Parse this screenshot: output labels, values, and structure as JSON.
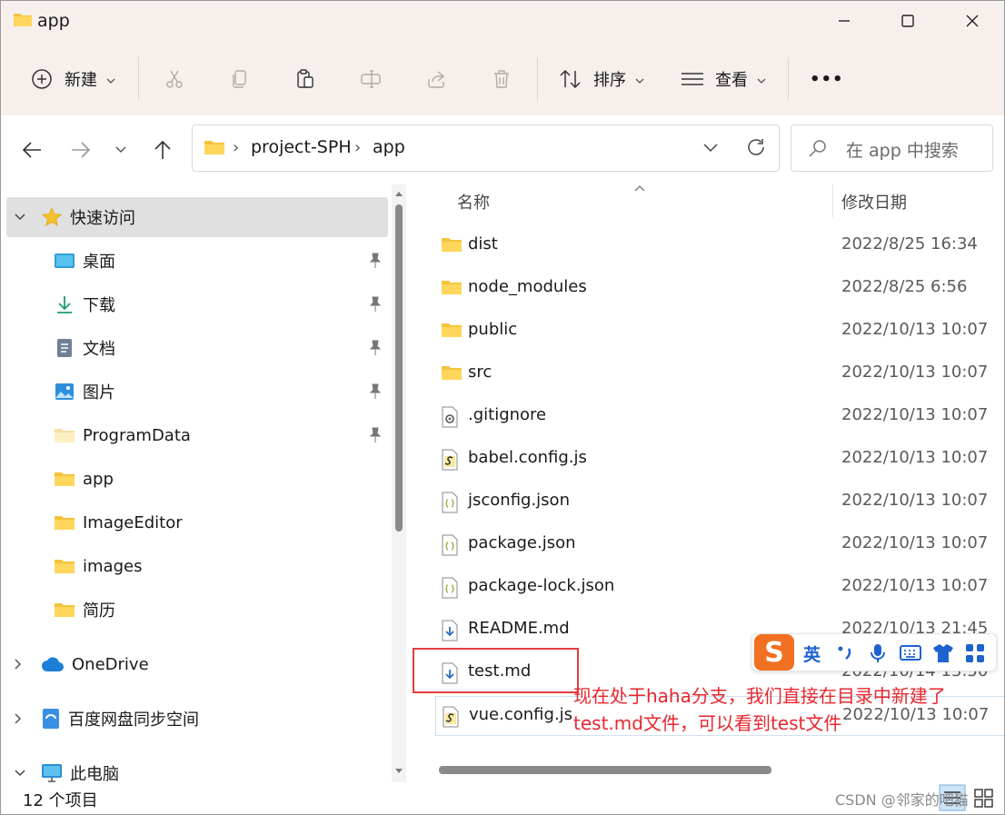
{
  "window": {
    "title": "app",
    "controls": {
      "minimize": "minimize",
      "maximize": "maximize",
      "close": "close"
    }
  },
  "toolbar": {
    "new_label": "新建",
    "sort_label": "排序",
    "view_label": "查看",
    "more_label": "•••"
  },
  "address": {
    "crumbs": [
      "project-SPH",
      "app"
    ],
    "separator": "›"
  },
  "search": {
    "placeholder": "在 app 中搜索"
  },
  "nav": {
    "quick_access": "快速访问",
    "items": [
      {
        "label": "桌面",
        "icon": "desktop-icon",
        "pinned": true
      },
      {
        "label": "下载",
        "icon": "download-icon",
        "pinned": true
      },
      {
        "label": "文档",
        "icon": "document-icon",
        "pinned": true
      },
      {
        "label": "图片",
        "icon": "picture-icon",
        "pinned": true
      },
      {
        "label": "ProgramData",
        "icon": "folder-icon",
        "pinned": true
      },
      {
        "label": "app",
        "icon": "folder-icon",
        "pinned": false
      },
      {
        "label": "ImageEditor",
        "icon": "folder-icon",
        "pinned": false
      },
      {
        "label": "images",
        "icon": "folder-icon",
        "pinned": false
      },
      {
        "label": "简历",
        "icon": "folder-icon",
        "pinned": false
      }
    ],
    "onedrive": "OneDrive",
    "baidu": "百度网盘同步空间",
    "this_pc": "此电脑"
  },
  "columns": {
    "name": "名称",
    "modified": "修改日期"
  },
  "files": [
    {
      "name": "dist",
      "date": "2022/8/25 16:34",
      "kind": "folder"
    },
    {
      "name": "node_modules",
      "date": "2022/8/25 6:56",
      "kind": "folder"
    },
    {
      "name": "public",
      "date": "2022/10/13 10:07",
      "kind": "folder"
    },
    {
      "name": "src",
      "date": "2022/10/13 10:07",
      "kind": "folder"
    },
    {
      "name": ".gitignore",
      "date": "2022/10/13 10:07",
      "kind": "config"
    },
    {
      "name": "babel.config.js",
      "date": "2022/10/13 10:07",
      "kind": "js"
    },
    {
      "name": "jsconfig.json",
      "date": "2022/10/13 10:07",
      "kind": "json"
    },
    {
      "name": "package.json",
      "date": "2022/10/13 10:07",
      "kind": "json"
    },
    {
      "name": "package-lock.json",
      "date": "2022/10/13 10:07",
      "kind": "json"
    },
    {
      "name": "README.md",
      "date": "2022/10/13 21:45",
      "kind": "md"
    },
    {
      "name": "test.md",
      "date": "2022/10/14 13:50",
      "kind": "md"
    },
    {
      "name": "vue.config.js",
      "date": "2022/10/13 10:07",
      "kind": "js"
    }
  ],
  "status": {
    "count": "12 个项目"
  },
  "annotation": {
    "line1": "现在处于haha分支，我们直接在目录中新建了",
    "line2": "test.md文件，可以看到test文件"
  },
  "ime": {
    "logo": "S",
    "mode": "英"
  },
  "watermark": "CSDN @邻家的吧猫",
  "colors": {
    "ribbon_bg": "#f6efec",
    "folder": "#f5c33b",
    "annotation": "#e8262e",
    "ime_logo": "#f27021"
  }
}
